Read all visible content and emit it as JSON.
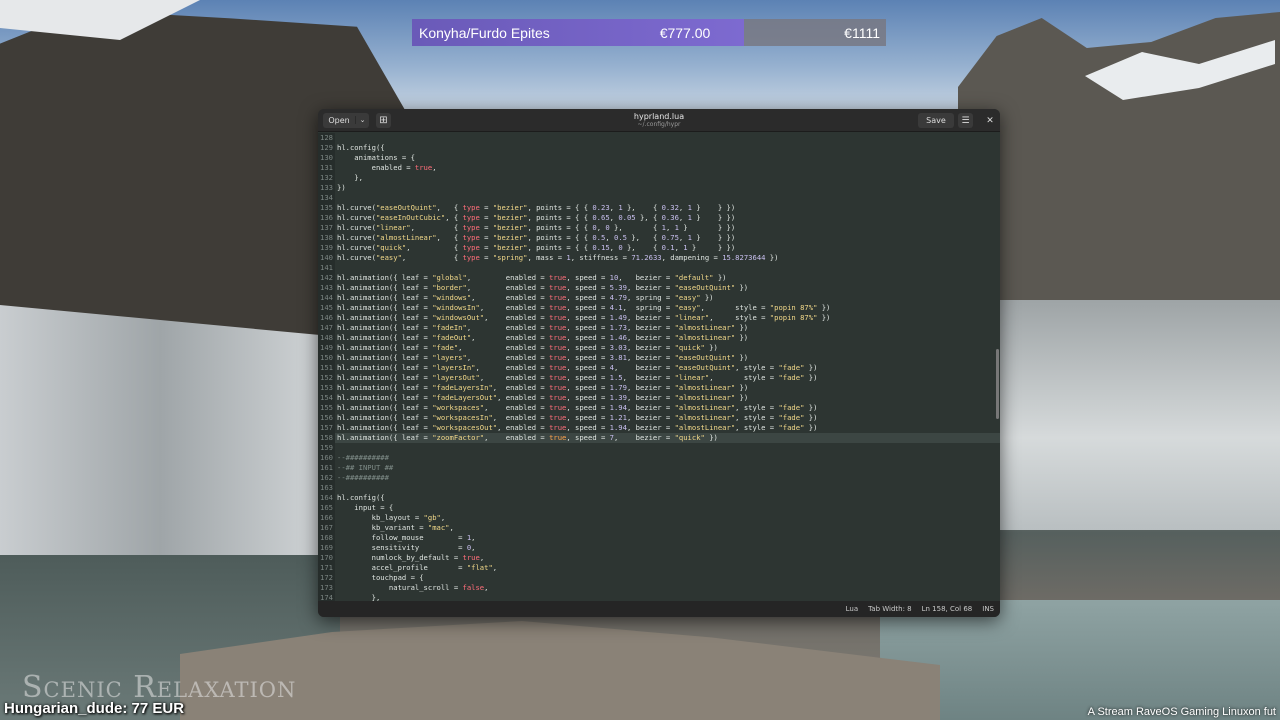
{
  "donation": {
    "name": "Konyha/Furdo Epites",
    "amount": "€777.00",
    "goal": "€1111",
    "progress": 0.7
  },
  "editor": {
    "open_label": "Open",
    "title": "hyprland.lua",
    "subtitle": "~/.config/hypr",
    "save_label": "Save",
    "status_lang": "Lua",
    "status_tab": "Tab Width: 8",
    "status_pos": "Ln 158, Col 68",
    "status_mode": "INS"
  },
  "code_lines": [
    {
      "n": "128",
      "h": ""
    },
    {
      "n": "129",
      "h": "hl.config({"
    },
    {
      "n": "130",
      "h": "    animations = {"
    },
    {
      "n": "131",
      "h": "        enabled = <span class=\"k\">true</span>,"
    },
    {
      "n": "132",
      "h": "    },"
    },
    {
      "n": "133",
      "h": "})"
    },
    {
      "n": "134",
      "h": ""
    },
    {
      "n": "135",
      "h": "hl.curve(<span class=\"s\">\"easeOutQuint\"</span>,   { <span class=\"k\">type</span> = <span class=\"s\">\"bezier\"</span>, points = { { <span class=\"n\">0.23</span>, <span class=\"n\">1</span> },    { <span class=\"n\">0.32</span>, <span class=\"n\">1</span> }    } })"
    },
    {
      "n": "136",
      "h": "hl.curve(<span class=\"s\">\"easeInOutCubic\"</span>, { <span class=\"k\">type</span> = <span class=\"s\">\"bezier\"</span>, points = { { <span class=\"n\">0.65</span>, <span class=\"n\">0.05</span> }, { <span class=\"n\">0.36</span>, <span class=\"n\">1</span> }    } })"
    },
    {
      "n": "137",
      "h": "hl.curve(<span class=\"s\">\"linear\"</span>,         { <span class=\"k\">type</span> = <span class=\"s\">\"bezier\"</span>, points = { { <span class=\"n\">0</span>, <span class=\"n\">0</span> },       { <span class=\"n\">1</span>, <span class=\"n\">1</span> }       } })"
    },
    {
      "n": "138",
      "h": "hl.curve(<span class=\"s\">\"almostLinear\"</span>,   { <span class=\"k\">type</span> = <span class=\"s\">\"bezier\"</span>, points = { { <span class=\"n\">0.5</span>, <span class=\"n\">0.5</span> },   { <span class=\"n\">0.75</span>, <span class=\"n\">1</span> }    } })"
    },
    {
      "n": "139",
      "h": "hl.curve(<span class=\"s\">\"quick\"</span>,          { <span class=\"k\">type</span> = <span class=\"s\">\"bezier\"</span>, points = { { <span class=\"n\">0.15</span>, <span class=\"n\">0</span> },    { <span class=\"n\">0.1</span>, <span class=\"n\">1</span> }     } })"
    },
    {
      "n": "140",
      "h": "hl.curve(<span class=\"s\">\"easy\"</span>,           { <span class=\"k\">type</span> = <span class=\"s\">\"spring\"</span>, mass = <span class=\"n\">1</span>, stiffness = <span class=\"n\">71.2633</span>, dampening = <span class=\"n\">15.8273644</span> })"
    },
    {
      "n": "141",
      "h": ""
    },
    {
      "n": "142",
      "h": "hl.animation({ leaf = <span class=\"s\">\"global\"</span>,        enabled = <span class=\"k\">true</span>, speed = <span class=\"n\">10</span>,   bezier = <span class=\"s\">\"default\"</span> })"
    },
    {
      "n": "143",
      "h": "hl.animation({ leaf = <span class=\"s\">\"border\"</span>,        enabled = <span class=\"k\">true</span>, speed = <span class=\"n\">5.39</span>, bezier = <span class=\"s\">\"easeOutQuint\"</span> })"
    },
    {
      "n": "144",
      "h": "hl.animation({ leaf = <span class=\"s\">\"windows\"</span>,       enabled = <span class=\"k\">true</span>, speed = <span class=\"n\">4.79</span>, spring = <span class=\"s\">\"easy\"</span> })"
    },
    {
      "n": "145",
      "h": "hl.animation({ leaf = <span class=\"s\">\"windowsIn\"</span>,     enabled = <span class=\"k\">true</span>, speed = <span class=\"n\">4.1</span>,  spring = <span class=\"s\">\"easy\"</span>,       style = <span class=\"s\">\"popin 87%\"</span> })"
    },
    {
      "n": "146",
      "h": "hl.animation({ leaf = <span class=\"s\">\"windowsOut\"</span>,    enabled = <span class=\"k\">true</span>, speed = <span class=\"n\">1.49</span>, bezier = <span class=\"s\">\"linear\"</span>,     style = <span class=\"s\">\"popin 87%\"</span> })"
    },
    {
      "n": "147",
      "h": "hl.animation({ leaf = <span class=\"s\">\"fadeIn\"</span>,        enabled = <span class=\"k\">true</span>, speed = <span class=\"n\">1.73</span>, bezier = <span class=\"s\">\"almostLinear\"</span> })"
    },
    {
      "n": "148",
      "h": "hl.animation({ leaf = <span class=\"s\">\"fadeOut\"</span>,       enabled = <span class=\"k\">true</span>, speed = <span class=\"n\">1.46</span>, bezier = <span class=\"s\">\"almostLinear\"</span> })"
    },
    {
      "n": "149",
      "h": "hl.animation({ leaf = <span class=\"s\">\"fade\"</span>,          enabled = <span class=\"k\">true</span>, speed = <span class=\"n\">3.03</span>, bezier = <span class=\"s\">\"quick\"</span> })"
    },
    {
      "n": "150",
      "h": "hl.animation({ leaf = <span class=\"s\">\"layers\"</span>,        enabled = <span class=\"k\">true</span>, speed = <span class=\"n\">3.81</span>, bezier = <span class=\"s\">\"easeOutQuint\"</span> })"
    },
    {
      "n": "151",
      "h": "hl.animation({ leaf = <span class=\"s\">\"layersIn\"</span>,      enabled = <span class=\"k\">true</span>, speed = <span class=\"n\">4</span>,    bezier = <span class=\"s\">\"easeOutQuint\"</span>, style = <span class=\"s\">\"fade\"</span> })"
    },
    {
      "n": "152",
      "h": "hl.animation({ leaf = <span class=\"s\">\"layersOut\"</span>,     enabled = <span class=\"k\">true</span>, speed = <span class=\"n\">1.5</span>,  bezier = <span class=\"s\">\"linear\"</span>,       style = <span class=\"s\">\"fade\"</span> })"
    },
    {
      "n": "153",
      "h": "hl.animation({ leaf = <span class=\"s\">\"fadeLayersIn\"</span>,  enabled = <span class=\"k\">true</span>, speed = <span class=\"n\">1.79</span>, bezier = <span class=\"s\">\"almostLinear\"</span> })"
    },
    {
      "n": "154",
      "h": "hl.animation({ leaf = <span class=\"s\">\"fadeLayersOut\"</span>, enabled = <span class=\"k\">true</span>, speed = <span class=\"n\">1.39</span>, bezier = <span class=\"s\">\"almostLinear\"</span> })"
    },
    {
      "n": "155",
      "h": "hl.animation({ leaf = <span class=\"s\">\"workspaces\"</span>,    enabled = <span class=\"k\">true</span>, speed = <span class=\"n\">1.94</span>, bezier = <span class=\"s\">\"almostLinear\"</span>, style = <span class=\"s\">\"fade\"</span> })"
    },
    {
      "n": "156",
      "h": "hl.animation({ leaf = <span class=\"s\">\"workspacesIn\"</span>,  enabled = <span class=\"k\">true</span>, speed = <span class=\"n\">1.21</span>, bezier = <span class=\"s\">\"almostLinear\"</span>, style = <span class=\"s\">\"fade\"</span> })"
    },
    {
      "n": "157",
      "h": "hl.animation({ leaf = <span class=\"s\">\"workspacesOut\"</span>, enabled = <span class=\"k\">true</span>, speed = <span class=\"n\">1.94</span>, bezier = <span class=\"s\">\"almostLinear\"</span>, style = <span class=\"s\">\"fade\"</span> })"
    },
    {
      "n": "158",
      "h": "hl.animation({ leaf = <span class=\"s\">\"zoomFactor\"</span>,    enabled = <span class=\"r\">true</span>, speed = <span class=\"n\">7</span>,    bezier = <span class=\"s\">\"quick\"</span> })",
      "hl": true
    },
    {
      "n": "159",
      "h": ""
    },
    {
      "n": "160",
      "h": "<span class=\"c\">--##########</span>"
    },
    {
      "n": "161",
      "h": "<span class=\"c\">--## INPUT ##</span>"
    },
    {
      "n": "162",
      "h": "<span class=\"c\">--##########</span>"
    },
    {
      "n": "163",
      "h": ""
    },
    {
      "n": "164",
      "h": "hl.config({"
    },
    {
      "n": "165",
      "h": "    input = {"
    },
    {
      "n": "166",
      "h": "        kb_layout = <span class=\"s\">\"gb\"</span>,"
    },
    {
      "n": "167",
      "h": "        kb_variant = <span class=\"s\">\"mac\"</span>,"
    },
    {
      "n": "168",
      "h": "        follow_mouse        = <span class=\"n\">1</span>,"
    },
    {
      "n": "169",
      "h": "        sensitivity         = <span class=\"n\">0</span>,"
    },
    {
      "n": "170",
      "h": "        numlock_by_default = <span class=\"k\">true</span>,"
    },
    {
      "n": "171",
      "h": "        accel_profile       = <span class=\"s\">\"flat\"</span>,"
    },
    {
      "n": "172",
      "h": "        touchpad = {"
    },
    {
      "n": "173",
      "h": "            natural_scroll = <span class=\"k\">false</span>,"
    },
    {
      "n": "174",
      "h": "        },"
    }
  ],
  "overlays": {
    "watermark": "Scenic Relaxation",
    "donor": "Hungarian_dude: 77 EUR",
    "ticker": "A Stream RaveOS Gaming Linuxon fut"
  }
}
